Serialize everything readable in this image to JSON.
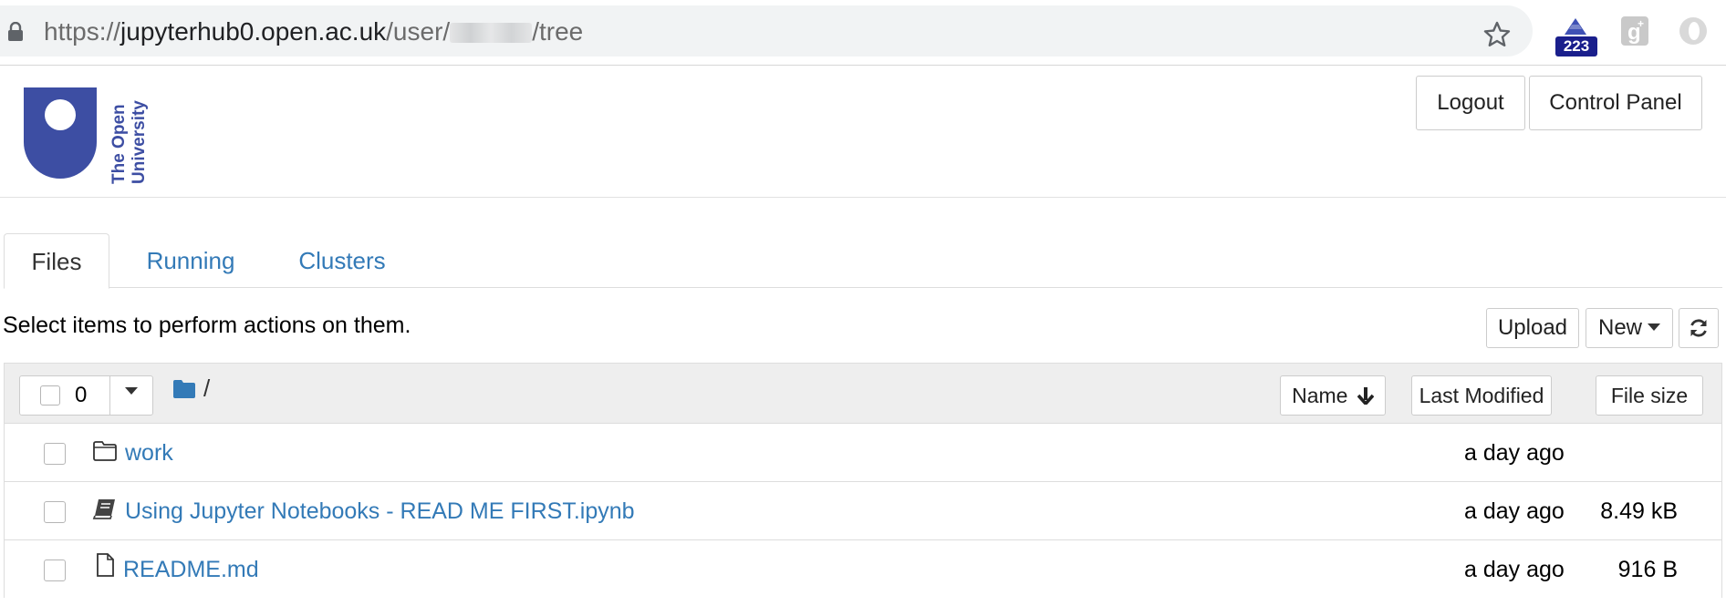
{
  "browser": {
    "url_scheme": "https://",
    "url_host": "jupyterhub0.open.ac.uk",
    "url_path_prefix": "/user/",
    "url_path_suffix": "/tree",
    "extension_badge": "223"
  },
  "header": {
    "logo_text_line1": "The Open",
    "logo_text_line2": "University",
    "logout_label": "Logout",
    "control_panel_label": "Control Panel"
  },
  "tabs": [
    {
      "label": "Files",
      "active": true
    },
    {
      "label": "Running",
      "active": false
    },
    {
      "label": "Clusters",
      "active": false
    }
  ],
  "toolbar": {
    "hint": "Select items to perform actions on them.",
    "upload_label": "Upload",
    "new_label": "New"
  },
  "list_header": {
    "selected_count": "0",
    "breadcrumb_root": "/",
    "sort_name_label": "Name",
    "sort_modified_label": "Last Modified",
    "sort_size_label": "File size"
  },
  "files": [
    {
      "name": "work",
      "type": "folder",
      "modified": "a day ago",
      "size": ""
    },
    {
      "name": "Using Jupyter Notebooks - READ ME FIRST.ipynb",
      "type": "notebook",
      "modified": "a day ago",
      "size": "8.49 kB"
    },
    {
      "name": "README.md",
      "type": "file",
      "modified": "a day ago",
      "size": "916 B"
    }
  ],
  "colors": {
    "link": "#337ab7",
    "ou_blue": "#3d4ea3",
    "extension_badge_bg": "#1a1f8c"
  },
  "icons": {
    "lock": "lock-icon",
    "star": "star-icon",
    "refresh": "refresh-icon",
    "folder": "folder-icon",
    "notebook": "notebook-icon",
    "file": "file-icon",
    "sort_arrow": "arrow-down-icon"
  }
}
